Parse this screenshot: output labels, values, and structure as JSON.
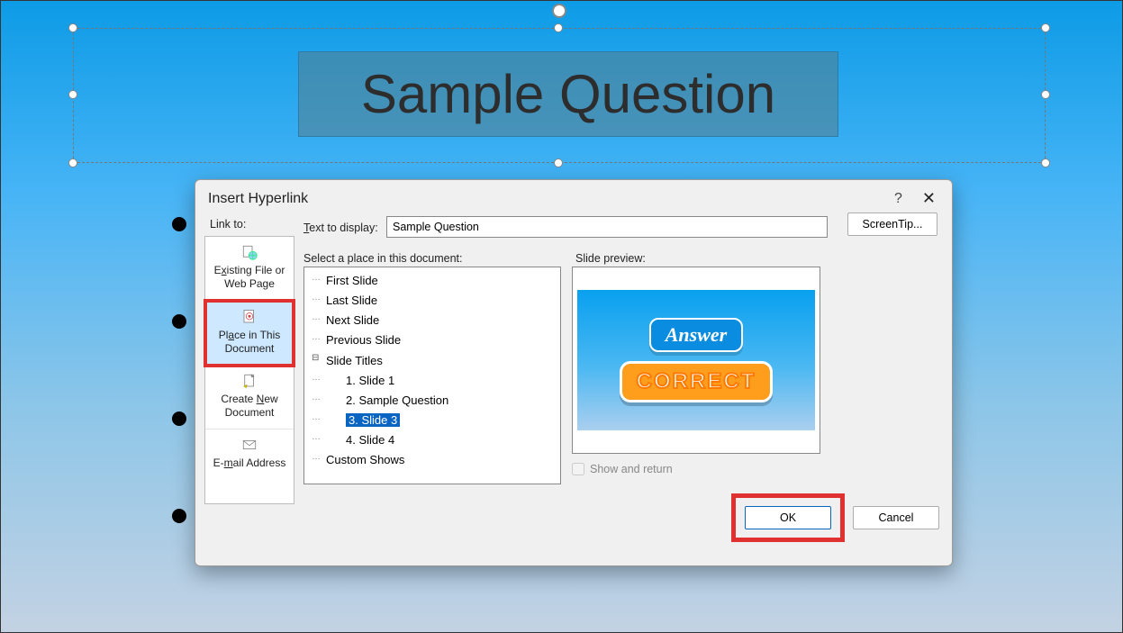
{
  "slide": {
    "title_text": "Sample Question"
  },
  "dialog": {
    "title": "Insert Hyperlink",
    "link_to_label": "Link to:",
    "link_to_items": [
      {
        "label_html": "E<u>x</u>isting File or Web Page",
        "id": "existing-file"
      },
      {
        "label_html": "Pl<u>a</u>ce in This Document",
        "id": "place-in-doc",
        "selected": true
      },
      {
        "label_html": "Create <u>N</u>ew Document",
        "id": "create-new"
      },
      {
        "label_html": "E-<u>m</u>ail Address",
        "id": "email"
      }
    ],
    "text_to_display_label": "Text to display:",
    "text_to_display_value": "Sample Question",
    "screentip_label": "ScreenTip...",
    "place_label": "Select a place in this document:",
    "tree": {
      "top": [
        "First Slide",
        "Last Slide",
        "Next Slide",
        "Previous Slide"
      ],
      "slide_titles_label": "Slide Titles",
      "slides": [
        "1. Slide 1",
        "2. Sample Question",
        "3. Slide 3",
        "4. Slide 4"
      ],
      "selected_index": 2,
      "custom_shows_label": "Custom Shows"
    },
    "preview_label": "Slide preview:",
    "preview": {
      "answer": "Answer",
      "correct": "CORRECT"
    },
    "show_and_return_label": "Show and return",
    "show_and_return_checked": false,
    "ok_label": "OK",
    "cancel_label": "Cancel"
  }
}
